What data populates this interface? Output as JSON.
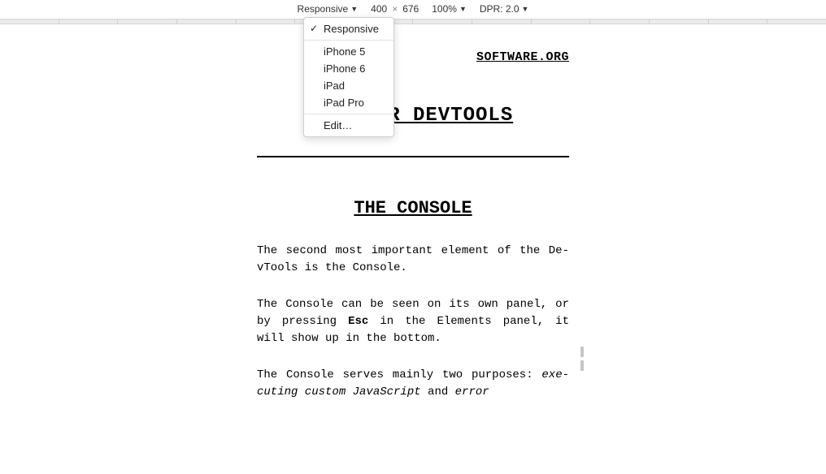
{
  "toolbar": {
    "device_label": "Responsive",
    "width": "400",
    "x": "×",
    "height": "676",
    "zoom": "100%",
    "dpr_label": "DPR: 2.0"
  },
  "dropdown": {
    "items": [
      {
        "label": "Responsive",
        "checked": true
      },
      {
        "label": "iPhone 5",
        "checked": false
      },
      {
        "label": "iPhone 6",
        "checked": false
      },
      {
        "label": "iPad",
        "checked": false
      },
      {
        "label": "iPad Pro",
        "checked": false
      }
    ],
    "edit_label": "Edit…"
  },
  "page": {
    "top_link": "SOFTWARE.ORG",
    "h1": "BROWSER DEVTOOLS",
    "h2": "THE CONSOLE",
    "p1_a": "The second most important element of the De-vTools is the Console.",
    "p2_a": "The Console can be seen on its own panel, or by pressing ",
    "p2_kbd": "Esc",
    "p2_b": " in the Elements panel, it will show up in the bottom.",
    "p3_a": "The Console serves mainly two purposes: ",
    "p3_em1": "exe-cuting custom JavaScript",
    "p3_b": " and ",
    "p3_em2": "error"
  }
}
